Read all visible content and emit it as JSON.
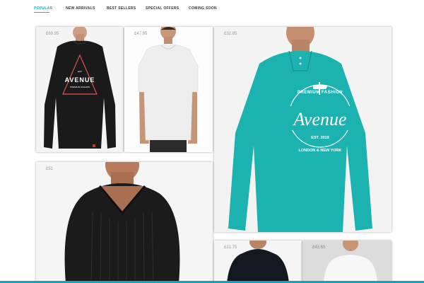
{
  "nav": {
    "items": [
      "POPULAR",
      "NEW ARRIVALS",
      "BEST SELLERS",
      "SPECIAL OFFERS",
      "COMING SOON"
    ],
    "active": "POPULAR"
  },
  "products": [
    {
      "price": "£69.95",
      "graphic_title": "AVENUE",
      "graphic_top": "EST",
      "graphic_sub": "PREMIUM FASHION",
      "shirt_color": "#1a1a1a"
    },
    {
      "price": "£47.95",
      "shirt_color": "#efefef"
    },
    {
      "price": "£32.85",
      "graphic_title": "Avenue",
      "graphic_top": "PREMIUM FASHION",
      "graphic_est": "EST. 2019",
      "graphic_bottom": "LONDON & NEW YORK",
      "shirt_color": "#1cb2b0"
    },
    {
      "price": "£51",
      "shirt_color": "#1b1b1b"
    },
    {
      "price": "£21.75",
      "shirt_color": "#141820"
    },
    {
      "price": "£43.65",
      "shirt_color": "#f6f6f6"
    }
  ],
  "colors": {
    "accent": "#1fb5b5",
    "bottom_bar": "#1a9fbf"
  }
}
